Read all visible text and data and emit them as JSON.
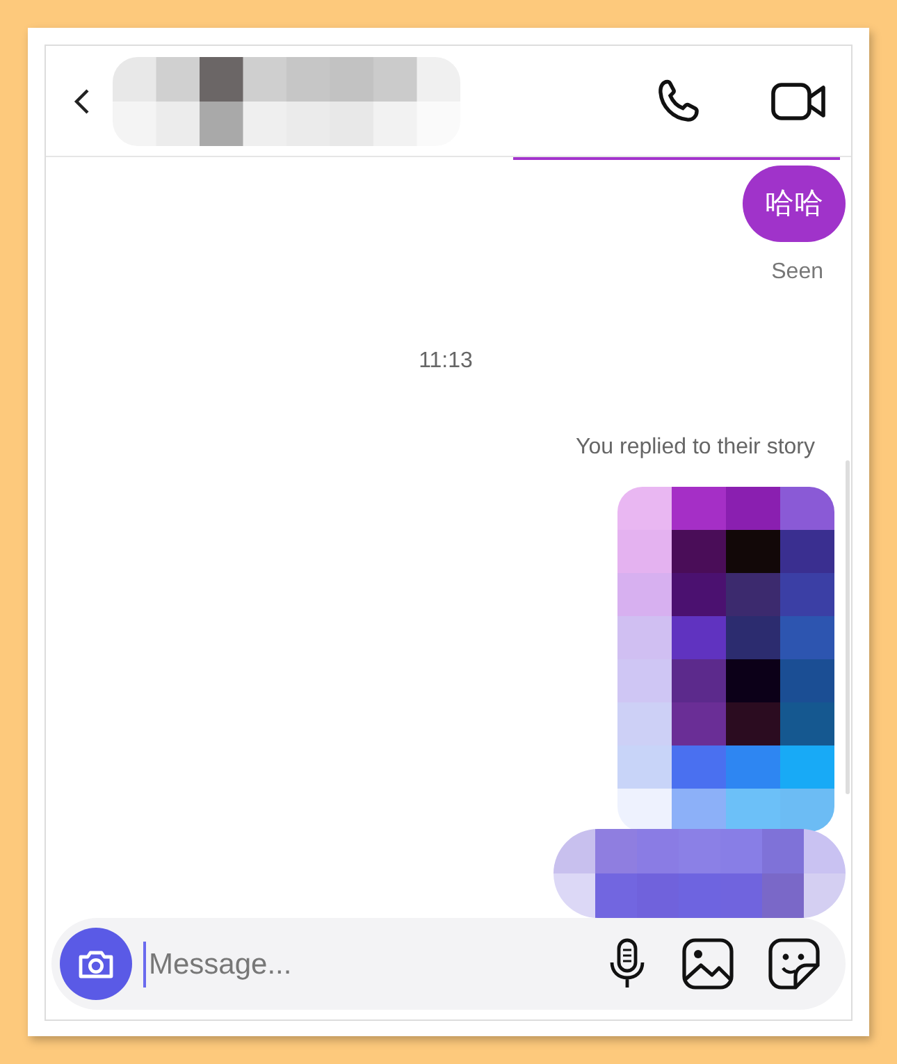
{
  "messages": [
    {
      "kind": "bubble",
      "text": "哈哈"
    },
    {
      "kind": "status",
      "text": "Seen"
    },
    {
      "kind": "time",
      "text": "11:13"
    },
    {
      "kind": "note",
      "text": "You replied to their story"
    },
    {
      "kind": "story"
    },
    {
      "kind": "blurred"
    }
  ],
  "composer": {
    "placeholder": "Message..."
  }
}
